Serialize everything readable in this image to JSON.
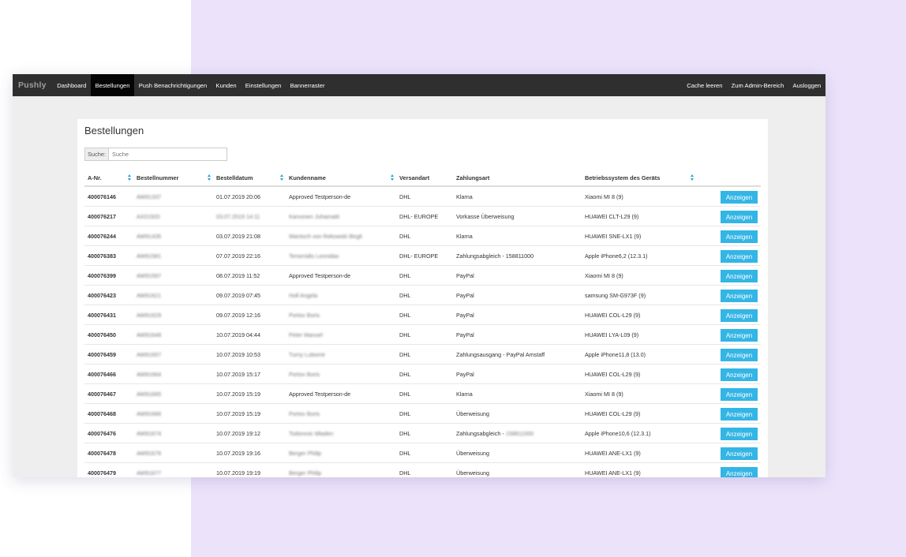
{
  "navbar": {
    "brand": "Pushly",
    "items": [
      {
        "label": "Dashboard",
        "active": false
      },
      {
        "label": "Bestellungen",
        "active": true
      },
      {
        "label": "Push Benachrichtigungen",
        "active": false
      },
      {
        "label": "Kunden",
        "active": false
      },
      {
        "label": "Einstellungen",
        "active": false
      },
      {
        "label": "Bannerraster",
        "active": false
      }
    ],
    "right_items": [
      {
        "label": "Cache leeren"
      },
      {
        "label": "Zum Admin-Bereich"
      },
      {
        "label": "Ausloggen"
      }
    ]
  },
  "page": {
    "title": "Bestellungen"
  },
  "search": {
    "label": "Suche:",
    "placeholder": "Suche",
    "value": ""
  },
  "table": {
    "columns": [
      "A-Nr.",
      "Bestellnummer",
      "Bestelldatum",
      "Kundenname",
      "Versandart",
      "Zahlungsart",
      "Betriebssystem des Geräts",
      ""
    ],
    "action_label": "Anzeigen",
    "rows": [
      {
        "anr": "400076146",
        "bestellnummer": "AW91337",
        "datum": "01.07.2019 20:06",
        "kunde": "Approved Testperson-de",
        "kunde_blurred": false,
        "versand": "DHL",
        "zahlung": "Klarna",
        "geraet": "Xiaomi MI 8 (9)"
      },
      {
        "anr": "400076217",
        "bestellnummer": "AX01920",
        "datum": "03.07.2019 14:11",
        "datum_blurred": true,
        "kunde": "Karvonen Juhamatti",
        "kunde_blurred": true,
        "versand": "DHL- EUROPE",
        "zahlung": "Vorkasse Überweisung",
        "geraet": "HUAWEI CLT-L29 (9)"
      },
      {
        "anr": "400076244",
        "bestellnummer": "AW91435",
        "datum": "03.07.2019 21:08",
        "kunde": "Wantoch von Rekowski Birgit",
        "kunde_blurred": true,
        "versand": "DHL",
        "zahlung": "Klarna",
        "geraet": "HUAWEI SNE-LX1 (9)"
      },
      {
        "anr": "400076383",
        "bestellnummer": "AW91581",
        "datum": "07.07.2019 22:16",
        "kunde": "Tersenidis Leonidas",
        "kunde_blurred": true,
        "versand": "DHL- EUROPE",
        "zahlung": "Zahlungsabgleich - 158811000",
        "geraet": "Apple iPhone6,2 (12.3.1)"
      },
      {
        "anr": "400076399",
        "bestellnummer": "AW91597",
        "datum": "08.07.2019 11:52",
        "kunde": "Approved Testperson-de",
        "kunde_blurred": false,
        "versand": "DHL",
        "zahlung": "PayPal",
        "geraet": "Xiaomi MI 8 (9)"
      },
      {
        "anr": "400076423",
        "bestellnummer": "AW91621",
        "datum": "09.07.2019 07:45",
        "kunde": "Holl Angela",
        "kunde_blurred": true,
        "versand": "DHL",
        "zahlung": "PayPal",
        "geraet": "samsung SM-G973F (9)"
      },
      {
        "anr": "400076431",
        "bestellnummer": "AW91629",
        "datum": "09.07.2019 12:16",
        "kunde": "Portov Boris",
        "kunde_blurred": true,
        "versand": "DHL",
        "zahlung": "PayPal",
        "geraet": "HUAWEI COL-L29 (9)"
      },
      {
        "anr": "400076450",
        "bestellnummer": "AW91648",
        "datum": "10.07.2019 04:44",
        "kunde": "Peter Manuel",
        "kunde_blurred": true,
        "versand": "DHL",
        "zahlung": "PayPal",
        "geraet": "HUAWEI LYA-L09 (9)"
      },
      {
        "anr": "400076459",
        "bestellnummer": "AW91657",
        "datum": "10.07.2019 10:53",
        "kunde": "Turny Lubomir",
        "kunde_blurred": true,
        "versand": "DHL",
        "zahlung": "Zahlungsausgang - PayPal Amstaff",
        "geraet": "Apple iPhone11,8 (13.0)"
      },
      {
        "anr": "400076466",
        "bestellnummer": "AW91664",
        "datum": "10.07.2019 15:17",
        "kunde": "Portov Boris",
        "kunde_blurred": true,
        "versand": "DHL",
        "zahlung": "PayPal",
        "geraet": "HUAWEI COL-L29 (9)"
      },
      {
        "anr": "400076467",
        "bestellnummer": "AW91665",
        "datum": "10.07.2019 15:19",
        "kunde": "Approved Testperson-de",
        "kunde_blurred": false,
        "versand": "DHL",
        "zahlung": "Klarna",
        "geraet": "Xiaomi MI 8 (9)"
      },
      {
        "anr": "400076468",
        "bestellnummer": "AW91666",
        "datum": "10.07.2019 15:19",
        "kunde": "Portov Boris",
        "kunde_blurred": true,
        "versand": "DHL",
        "zahlung": "Überweisung",
        "geraet": "HUAWEI COL-L29 (9)"
      },
      {
        "anr": "400076476",
        "bestellnummer": "AW91674",
        "datum": "10.07.2019 19:12",
        "kunde": "Todorovic Mladen",
        "kunde_blurred": true,
        "versand": "DHL",
        "zahlung": "Zahlungsabgleich - ",
        "zahlung_blur_suffix": "158811000",
        "geraet": "Apple iPhone10,6 (12.3.1)"
      },
      {
        "anr": "400076478",
        "bestellnummer": "AW91676",
        "datum": "10.07.2019 19:16",
        "kunde": "Berger Philip",
        "kunde_blurred": true,
        "versand": "DHL",
        "zahlung": "Überweisung",
        "geraet": "HUAWEI ANE-LX1 (9)"
      },
      {
        "anr": "400076479",
        "bestellnummer": "AW91677",
        "datum": "10.07.2019 19:19",
        "kunde": "Berger Philip",
        "kunde_blurred": true,
        "versand": "DHL",
        "zahlung": "Überweisung",
        "geraet": "HUAWEI ANE-LX1 (9)"
      }
    ]
  },
  "colors": {
    "navbar_bg": "#2f2f2f",
    "navbar_active_bg": "#050505",
    "button_bg": "#33b5e5",
    "sort_icon": "#2a9fd6",
    "background_accent": "#ece3fb"
  }
}
